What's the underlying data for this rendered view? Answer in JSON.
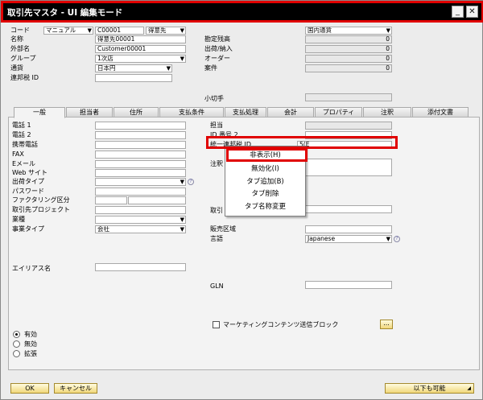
{
  "window": {
    "title": "取引先マスタ - UI 編集モード",
    "minimize": "_",
    "close": "✕"
  },
  "header": {
    "code_label": "コード",
    "code_mode": "マニュアル",
    "code_value": "C00001",
    "code_type": "得意先",
    "name_label": "名称",
    "name_value": "得意先00001",
    "foreign_name_label": "外部名",
    "foreign_name_value": "Customer00001",
    "group_label": "グループ",
    "group_value": "1次店",
    "currency_label": "通貨",
    "currency_value": "日本円",
    "tax_id_label": "連邦税 ID",
    "region_value": "国内通貨",
    "balance_label": "勘定残高",
    "balance_value": "0",
    "shipments_label": "出荷/納入",
    "shipments_value": "0",
    "orders_label": "オーダー",
    "orders_value": "0",
    "opportunities_label": "案件",
    "opportunities_value": "0",
    "check_label": "小切手"
  },
  "tabs": [
    "一般",
    "担当者",
    "住所",
    "支払条件",
    "支払処理",
    "会計",
    "プロパティ",
    "注釈",
    "添付文書"
  ],
  "left": {
    "tel1": "電話 1",
    "tel2": "電話 2",
    "mobile": "携帯電話",
    "fax": "FAX",
    "email": "Eメール",
    "web": "Web サイト",
    "ship_type_label": "出荷タイプ",
    "password": "パスワード",
    "factoring_label": "ファクタリング区分",
    "project_label": "取引先プロジェクト",
    "industry_label": "業種",
    "business_type_label": "事業タイプ",
    "business_type_value": "会社",
    "alias_label": "エイリアス名"
  },
  "right": {
    "contact_label": "担当",
    "id2_label": "ID 番号 2",
    "unified_tax_label": "統一連邦税 ID",
    "unified_tax_value": "5(E",
    "remarks_label": "注釈",
    "buyer_label": "取引",
    "sales_area_label": "販売区域",
    "language_label": "言語",
    "language_value": "Japanese",
    "gln_label": "GLN",
    "marketing_label": "マーケティングコンテンツ送信ブロック",
    "ellipsis": "..."
  },
  "status": {
    "active": "有効",
    "inactive": "無効",
    "advanced": "拡張"
  },
  "context_menu": [
    "非表示(H)",
    "無効化(I)",
    "タブ追加(B)",
    "タブ削除",
    "タブ名称変更"
  ],
  "footer": {
    "ok": "OK",
    "cancel": "キャンセル",
    "copy_to": "以下も可能"
  }
}
